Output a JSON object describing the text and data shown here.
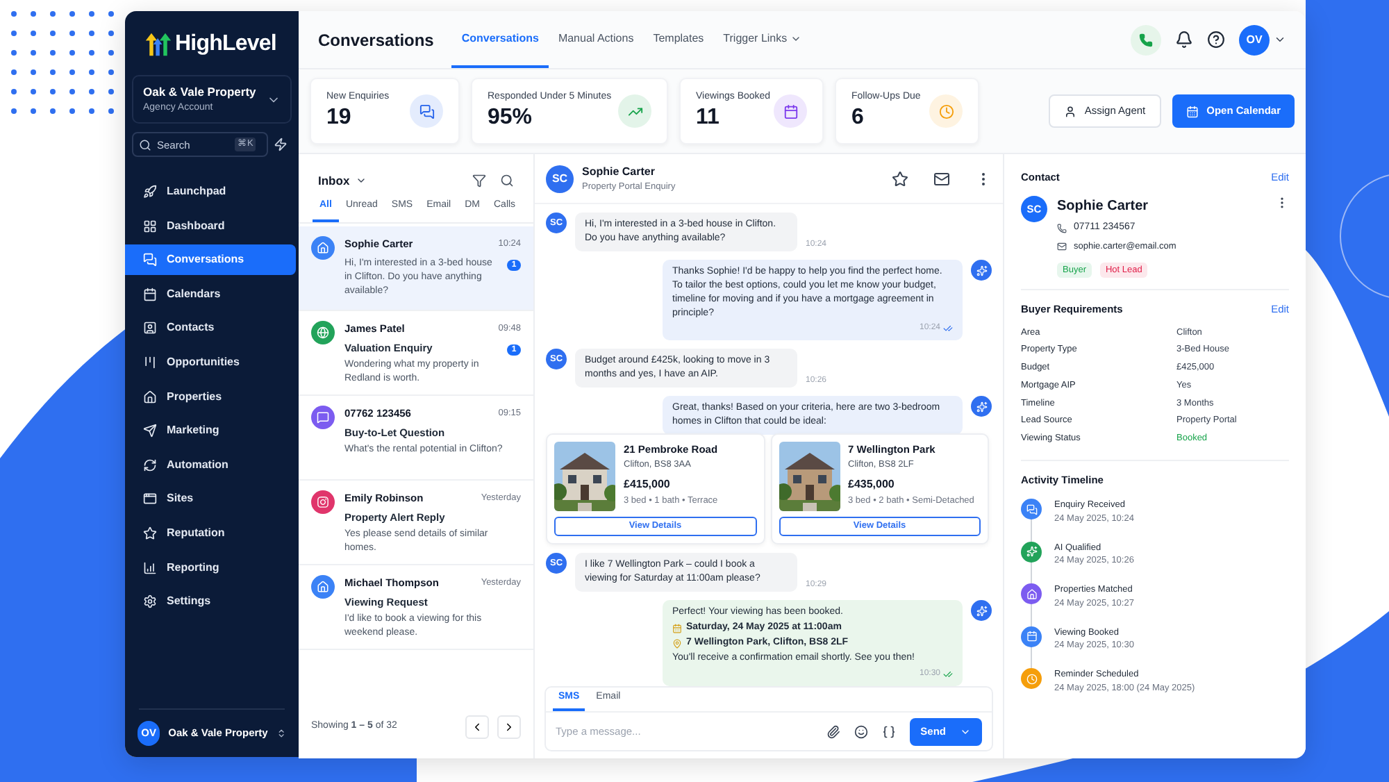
{
  "sidebar": {
    "logo": "HighLevel",
    "account": {
      "name": "Oak & Vale Property",
      "subtitle": "Agency Account"
    },
    "search": {
      "placeholder": "Search",
      "shortcut": "⌘K"
    },
    "items": [
      {
        "label": "Launchpad",
        "selected": false
      },
      {
        "label": "Dashboard",
        "selected": false
      },
      {
        "label": "Conversations",
        "selected": true
      },
      {
        "label": "Calendars",
        "selected": false
      },
      {
        "label": "Contacts",
        "selected": false
      },
      {
        "label": "Opportunities",
        "selected": false
      },
      {
        "label": "Properties",
        "selected": false
      },
      {
        "label": "Marketing",
        "selected": false
      },
      {
        "label": "Automation",
        "selected": false
      },
      {
        "label": "Sites",
        "selected": false
      },
      {
        "label": "Reputation",
        "selected": false
      },
      {
        "label": "Reporting",
        "selected": false
      },
      {
        "label": "Settings",
        "selected": false
      }
    ],
    "footer": {
      "initials": "OV",
      "name": "Oak & Vale Property"
    }
  },
  "header": {
    "title": "Conversations",
    "tabs": [
      {
        "label": "Conversations",
        "selected": true,
        "dropdown": false
      },
      {
        "label": "Manual Actions",
        "selected": false,
        "dropdown": false
      },
      {
        "label": "Templates",
        "selected": false,
        "dropdown": false
      },
      {
        "label": "Trigger Links",
        "selected": false,
        "dropdown": true
      }
    ],
    "avatar": "OV"
  },
  "stats": [
    {
      "label": "New Enquiries",
      "value": "19",
      "color": "#2563eb"
    },
    {
      "label": "Responded Under 5 Minutes",
      "value": "95%",
      "color": "#16a34a"
    },
    {
      "label": "Viewings Booked",
      "value": "11",
      "color": "#7c3aed"
    },
    {
      "label": "Follow-Ups Due",
      "value": "6",
      "color": "#f59e0b"
    }
  ],
  "actions": [
    {
      "label": "Assign Agent",
      "kind": "secondary"
    },
    {
      "label": "Open Calendar",
      "kind": "primary"
    }
  ],
  "inbox": {
    "title": "Inbox",
    "filters": [
      {
        "label": "All",
        "selected": true
      },
      {
        "label": "Unread",
        "selected": false
      },
      {
        "label": "SMS",
        "selected": false
      },
      {
        "label": "Email",
        "selected": false
      },
      {
        "label": "DM",
        "selected": false
      },
      {
        "label": "Calls",
        "selected": false
      }
    ],
    "conversations": [
      {
        "name": "Sophie Carter",
        "time": "10:24",
        "preview": "Hi, I'm interested in a 3-bed house in Clifton. Do you have anything available?",
        "unread": "1",
        "color": "#3b82f6",
        "selected": true
      },
      {
        "name": "James Patel",
        "time": "09:48",
        "subject": "Valuation Enquiry",
        "preview": "Wondering what my property in Redland is worth.",
        "unread": "1",
        "color": "#22a35a",
        "selected": false
      },
      {
        "name": "07762 123456",
        "time": "09:15",
        "subject": "Buy-to-Let Question",
        "preview": "What's the rental potential in Clifton?",
        "color": "#7c5cf0",
        "selected": false
      },
      {
        "name": "Emily Robinson",
        "time": "Yesterday",
        "subject": "Property Alert Reply",
        "preview": "Yes please send details of similar homes.",
        "color": "#e0356b",
        "selected": false
      },
      {
        "name": "Michael Thompson",
        "time": "Yesterday",
        "subject": "Viewing Request",
        "preview": "I'd like to book a viewing for this weekend please.",
        "color": "#3b82f6",
        "selected": false
      }
    ],
    "pagination": "Showing **1 – 5** of 32"
  },
  "chat": {
    "contact": {
      "initials": "SC",
      "name": "Sophie Carter",
      "source": "Property Portal Enquiry"
    },
    "messages": [
      {
        "kind": "incoming",
        "initials": "SC",
        "text": "Hi, I'm interested in a 3-bed house in Clifton. Do you have anything available?",
        "time": "10:24"
      },
      {
        "kind": "outgoing",
        "text": "Thanks Sophie! I'd be happy to help you find the perfect home. To tailor the best options, could you let me know your budget, timeline for moving and if you have a mortgage agreement in principle?",
        "time": "10:24",
        "read": true
      },
      {
        "kind": "incoming",
        "initials": "SC",
        "text": "Budget around £425k, looking to move in 3 months and yes, I have an AIP.",
        "time": "10:26"
      },
      {
        "kind": "outgoing",
        "text": "Great, thanks! Based on your criteria, here are two 3-bedroom homes in Clifton that could be ideal:",
        "listings": [
          {
            "title": "21 Pembroke Road",
            "area": "Clifton, BS8 3AA",
            "price": "£415,000",
            "details": "3 bed • 1 bath • Terrace",
            "button": "View Details"
          },
          {
            "title": "7 Wellington Park",
            "area": "Clifton, BS8 2LF",
            "price": "£435,000",
            "details": "3 bed • 2 bath • Semi-Detached",
            "button": "View Details"
          }
        ]
      },
      {
        "kind": "incoming",
        "initials": "SC",
        "text": "I like 7 Wellington Park – could I book a viewing for Saturday at 11:00am please?",
        "time": "10:29"
      },
      {
        "kind": "confirmation",
        "text": "Perfect! Your viewing has been booked.",
        "date": "Saturday, 24 May 2025 at 11:00am",
        "address": "7 Wellington Park, Clifton, BS8 2LF",
        "note": "You'll receive a confirmation email shortly. See you then!",
        "time": "10:30",
        "read": true
      }
    ],
    "composer": {
      "tabs": [
        {
          "label": "SMS",
          "selected": true
        },
        {
          "label": "Email",
          "selected": false
        }
      ],
      "placeholder": "Type a message...",
      "send": "Send"
    }
  },
  "contact": {
    "title": "Contact",
    "edit": "Edit",
    "initials": "SC",
    "name": "Sophie Carter",
    "phone": "07711 234567",
    "email": "sophie.carter@email.com",
    "tags": [
      {
        "label": "Buyer",
        "color": "#16a34a"
      },
      {
        "label": "Hot Lead",
        "color": "#e11d48"
      }
    ]
  },
  "requirements": {
    "title": "Buyer Requirements",
    "edit": "Edit",
    "rows": [
      {
        "label": "Area",
        "value": "Clifton",
        "kind": "text"
      },
      {
        "label": "Property Type",
        "value": "3-Bed House",
        "kind": "text"
      },
      {
        "label": "Budget",
        "value": "£425,000",
        "kind": "text"
      },
      {
        "label": "Mortgage AIP",
        "value": "Yes",
        "kind": "text"
      },
      {
        "label": "Timeline",
        "value": "3 Months",
        "kind": "text"
      },
      {
        "label": "Lead Source",
        "value": "Property Portal",
        "kind": "text"
      },
      {
        "label": "Viewing Status",
        "value": "Booked",
        "kind": "status"
      }
    ]
  },
  "timeline": {
    "title": "Activity Timeline",
    "events": [
      {
        "label": "Enquiry Received",
        "time": "24 May 2025, 10:24",
        "color": "#3b82f6"
      },
      {
        "label": "AI Qualified",
        "time": "24 May 2025, 10:26",
        "color": "#22a35a"
      },
      {
        "label": "Properties Matched",
        "time": "24 May 2025, 10:27",
        "color": "#7c5cf0"
      },
      {
        "label": "Viewing Booked",
        "time": "24 May 2025, 10:30",
        "color": "#3b82f6"
      },
      {
        "label": "Reminder Scheduled",
        "time": "24 May 2025, 18:00 (24 May 2025)",
        "color": "#f59e0b"
      }
    ]
  }
}
